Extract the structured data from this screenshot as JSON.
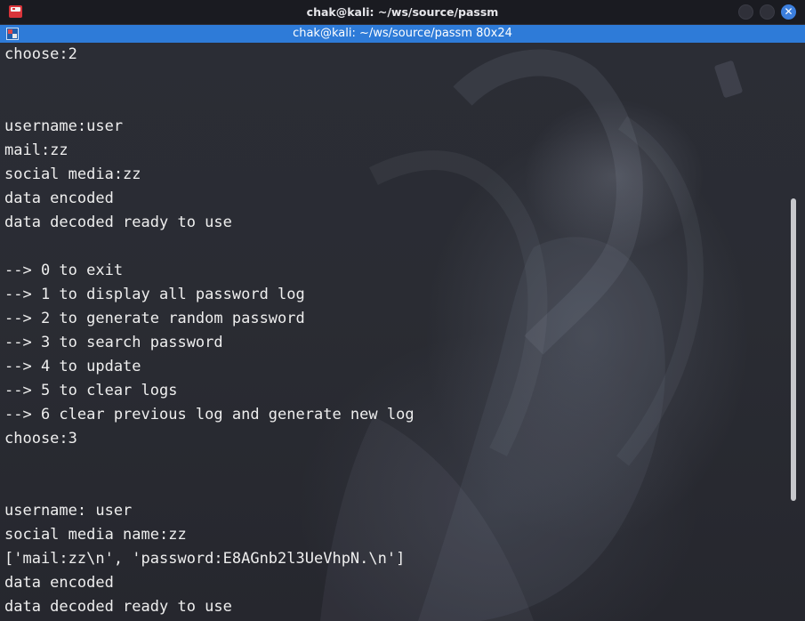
{
  "window": {
    "title": "chak@kali: ~/ws/source/passm"
  },
  "tab": {
    "title": "chak@kali: ~/ws/source/passm 80x24"
  },
  "controls": {
    "close_glyph": "✕"
  },
  "terminal": {
    "lines": [
      "choose:2",
      "",
      "",
      "username:user",
      "mail:zz",
      "social media:zz",
      "data encoded",
      "data decoded ready to use",
      "",
      "--> 0 to exit",
      "--> 1 to display all password log",
      "--> 2 to generate random password",
      "--> 3 to search password",
      "--> 4 to update",
      "--> 5 to clear logs",
      "--> 6 clear previous log and generate new log",
      "choose:3",
      "",
      "",
      "username: user",
      "social media name:zz",
      "['mail:zz\\n', 'password:E8AGnb2l3UeVhpN.\\n']",
      "data encoded",
      "data decoded ready to use"
    ]
  },
  "colors": {
    "tab_accent": "#2e7bd8",
    "close_button": "#3c7fde",
    "text": "#eeeeee"
  }
}
